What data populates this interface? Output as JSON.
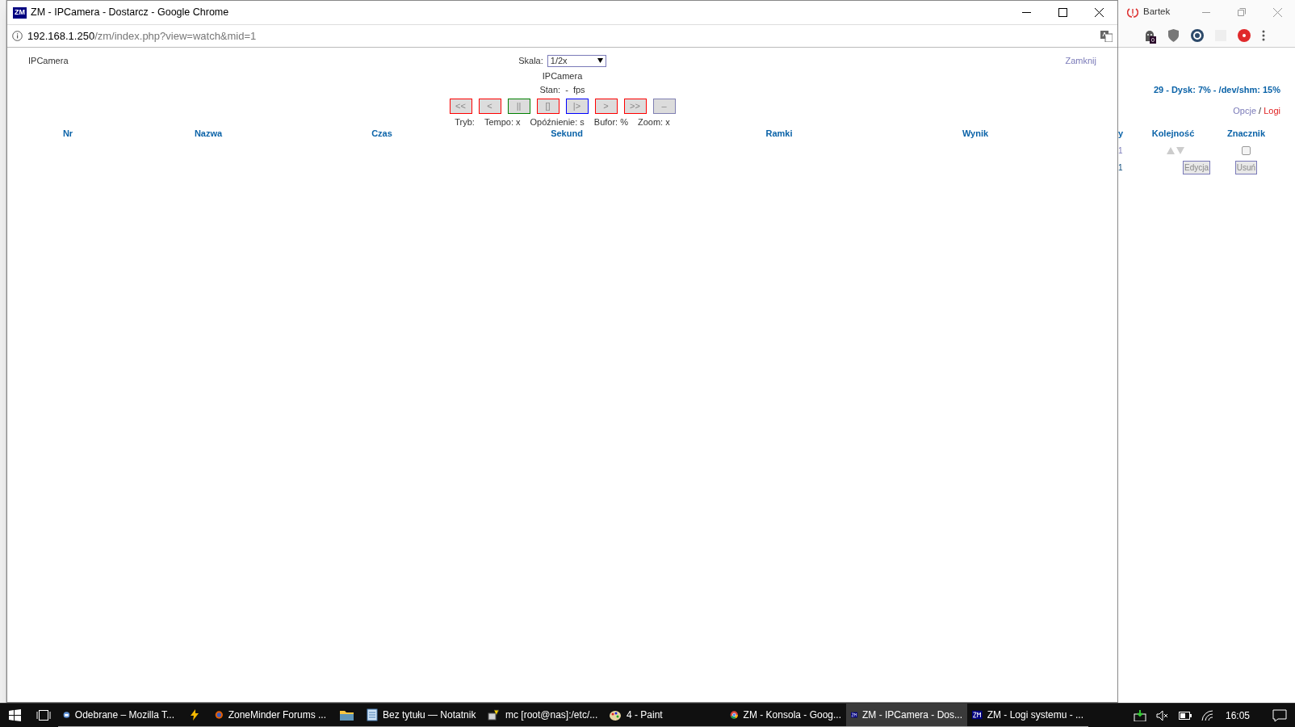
{
  "popup": {
    "logo": "ZM",
    "title": "ZM - IPCamera - Dostarcz - Google Chrome",
    "url_host": "192.168.1.250",
    "url_path": "/zm/index.php?view=watch&mid=1"
  },
  "watch": {
    "monitor_name": "IPCamera",
    "scale_label": "Skala:",
    "scale_value": "1/2x",
    "close_link": "Zamknij",
    "camera_title": "IPCamera",
    "status": "Stan:  -  fps",
    "controls": [
      {
        "label": "<<",
        "color": "#ff0000"
      },
      {
        "label": "<",
        "color": "#ff0000"
      },
      {
        "label": "||",
        "color": "#008000"
      },
      {
        "label": "[]",
        "color": "#ff0000"
      },
      {
        "label": "|>",
        "color": "#0000ff"
      },
      {
        "label": ">",
        "color": "#ff0000"
      },
      {
        "label": ">>",
        "color": "#ff0000"
      },
      {
        "label": "–",
        "color": "#7f7fb2"
      }
    ],
    "stats": [
      "Tryb:",
      "Tempo: x",
      "Opóźnienie: s",
      "Bufor: %",
      "Zoom: x"
    ],
    "columns": [
      "Nr",
      "Nazwa",
      "Czas",
      "Sekund",
      "Ramki",
      "Wynik"
    ]
  },
  "background_window": {
    "profile": "Bartek",
    "extension_badge": "0",
    "summary": "29 - Dysk: 7% - /dev/shm: 15%",
    "options_link": "Opcje",
    "separator": "/",
    "logs_link": "Logi",
    "columns": [
      "y",
      "Kolejność",
      "Znacznik"
    ],
    "rows": [
      {
        "value": "1",
        "checked": false
      },
      {
        "value": "1",
        "edit": "Edycja",
        "delete": "Usuń"
      }
    ]
  },
  "taskbar": {
    "items": [
      {
        "label": "Odebrane – Mozilla T...",
        "kind": "mail",
        "selected": false
      },
      {
        "kind": "bolt",
        "selected": false
      },
      {
        "label": "ZoneMinder Forums ...",
        "kind": "firefox",
        "selected": false
      },
      {
        "kind": "folder",
        "selected": false
      },
      {
        "label": "Bez tytułu — Notatnik",
        "kind": "notepad",
        "selected": false
      },
      {
        "label": "mc [root@nas]:/etc/...",
        "kind": "terminal",
        "selected": false
      },
      {
        "label": "4 - Paint",
        "kind": "paint",
        "selected": false
      },
      {
        "label": "ZM - Konsola - Goog...",
        "kind": "chrome",
        "selected": false
      },
      {
        "label": "ZM - IPCamera - Dos...",
        "kind": "zm",
        "selected": true
      },
      {
        "label": "ZM - Logi systemu - ...",
        "kind": "zm",
        "selected": false
      }
    ],
    "clock": "16:05"
  }
}
